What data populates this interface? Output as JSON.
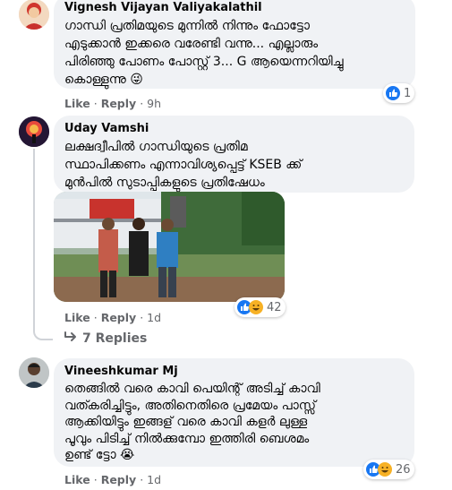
{
  "comments": [
    {
      "author": "Vignesh Vijayan Valiyakalathil",
      "text": "ഗാന്ധി പ്രതിമയുടെ മുന്നിൽ നിന്നും ഫോട്ടോ\nഎടുക്കാൻ ഇക്കരെ വരേണ്ടി വന്നു... എല്ലാരും\nപിരിഞ്ഞു പോണം പോസ്റ്റ് 3... G ആയെന്നറിയിച്ചു\nകൊള്ളുന്നു 😜",
      "like": "Like",
      "reply": "Reply",
      "time": "9h",
      "reaction_count": "1"
    },
    {
      "author": "Uday Vamshi",
      "text": "ലക്ഷദ്വീപിൽ ഗാന്ധിയുടെ പ്രതിമ\nസ്ഥാപിക്കണം എന്നാവിശ്യപ്പെട്ട് KSEB ക്ക്\nമുൻപിൽ സുടാപ്പികളുടെ പ്രതിഷേധം",
      "like": "Like",
      "reply": "Reply",
      "time": "1d",
      "reaction_count": "42",
      "replies_label": "7 Replies"
    },
    {
      "author": "Vineeshkumar Mj",
      "text": "തെങ്ങിൽ വരെ കാവി പെയിന്റ് അടിച്ച് കാവി\nവത്കരിച്ചിട്ടും, അതിനെതിരെ പ്രമേയം പാസ്സ്\nആക്കിയിട്ടും ഇങ്ങള് വരെ കാവി കളർ ലുള്ള\nപൂവും പിടിച്ച് നിൽക്കുമ്പോ ഇത്തിരി ബെശമം\nഉണ്ട് ട്ടോ 😭",
      "like": "Like",
      "reply": "Reply",
      "time": "1d",
      "reaction_count": "26"
    }
  ],
  "icons": {
    "like": "like-reaction-icon",
    "haha": "haha-reaction-icon",
    "reply_arrow": "reply-arrow-icon"
  },
  "colors": {
    "bubble": "#f0f2f5",
    "like_blue": "#1877f2",
    "haha_yellow": "#f7b125",
    "secondary_text": "#65676b"
  }
}
